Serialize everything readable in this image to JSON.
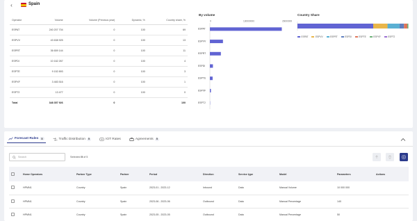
{
  "header": {
    "country": "Spain",
    "back_icon": "chevron-left-icon",
    "flag_icon": "spain-flag-icon"
  },
  "operators_table": {
    "columns": [
      "Operator",
      "Volume",
      "Volume (Previous year)",
      "Dynamic, %",
      "Country share, %"
    ],
    "rows": [
      [
        "ESPAT",
        "240 207 704",
        "0",
        "100",
        "69"
      ],
      [
        "ESPVV",
        "43 638 925",
        "0",
        "100",
        "13"
      ],
      [
        "ESPRT",
        "36 659 144",
        "0",
        "100",
        "11"
      ],
      [
        "ESPDI",
        "10 162 267",
        "0",
        "100",
        "4"
      ],
      [
        "ESPTE",
        "9 152 893",
        "0",
        "100",
        "3"
      ],
      [
        "ESPXF",
        "3 483 516",
        "0",
        "100",
        "1"
      ],
      [
        "ESPT2",
        "13 477",
        "0",
        "100",
        "0"
      ]
    ],
    "total": [
      "Total",
      "348 357 926",
      "0",
      "",
      "100"
    ]
  },
  "chart_data": [
    {
      "type": "bar",
      "orientation": "horizontal",
      "title": "By volume",
      "categories": [
        "ESPAT",
        "ESPVV",
        "ESPRT",
        "ESPDI",
        "ESPTE",
        "ESPXF",
        "ESPT2"
      ],
      "values": [
        240207704,
        43638925,
        36659144,
        10162267,
        9152893,
        3483516,
        13477
      ],
      "xlim": [
        0,
        260000000
      ],
      "xticks": [
        "0",
        "130000000",
        "260000000"
      ],
      "xtick_values": [
        0,
        130000000,
        260000000
      ],
      "color": "#6164d3",
      "grid": false
    },
    {
      "type": "bar",
      "orientation": "stacked-horizontal",
      "title": "Country Share",
      "series": [
        {
          "name": "ESPAT",
          "values": [
            69
          ],
          "color": "#6164d3"
        },
        {
          "name": "ESPVV",
          "values": [
            13
          ],
          "color": "#e9b64a"
        },
        {
          "name": "ESPRT",
          "values": [
            11
          ],
          "color": "#5ab0d3"
        },
        {
          "name": "ESPDI",
          "values": [
            4
          ],
          "color": "#5f7fbf"
        },
        {
          "name": "ESPTE",
          "values": [
            3
          ],
          "color": "#e0765a"
        },
        {
          "name": "ESPXF",
          "values": [
            1
          ],
          "color": "#6fb37a"
        },
        {
          "name": "ESPT2",
          "values": [
            0
          ],
          "color": "#9b6fd3"
        }
      ],
      "xlim": [
        0,
        100
      ],
      "legend": "bottom"
    }
  ],
  "tabs": [
    {
      "label": "Forecast Rules",
      "count": "5",
      "icon": "trend-icon",
      "active": true
    },
    {
      "label": "Traffic Distribution",
      "count": "5",
      "icon": "distribution-icon",
      "active": false
    },
    {
      "label": "IOT Rates",
      "count": "",
      "icon": "rates-icon",
      "active": false
    },
    {
      "label": "Agreements",
      "count": "5",
      "icon": "briefcase-icon",
      "active": false
    }
  ],
  "toolbar": {
    "search_placeholder": "Search",
    "selected_prefix": "Selected",
    "selected_count": "0",
    "selected_suffix": "of 5"
  },
  "rules_table": {
    "columns": [
      "Home Operators",
      "Partner Type",
      "Partner",
      "Period",
      "Direction",
      "Service type",
      "Model",
      "Parameters",
      "Actions"
    ],
    "rows": [
      [
        "HPMN1",
        "Country",
        "Spain",
        "2023-01 - 2023-12",
        "Inbound",
        "Data",
        "Manual Volume",
        "10 000 000",
        ""
      ],
      [
        "HPMN1",
        "Country",
        "Spain",
        "2023-06 - 2023-06",
        "Outbound",
        "Data",
        "Manual Percentage",
        "140",
        ""
      ],
      [
        "HPMN1",
        "Country",
        "Spain",
        "2023-05 - 2023-05",
        "Outbound",
        "Data",
        "Manual Percentage",
        "50",
        ""
      ]
    ]
  }
}
